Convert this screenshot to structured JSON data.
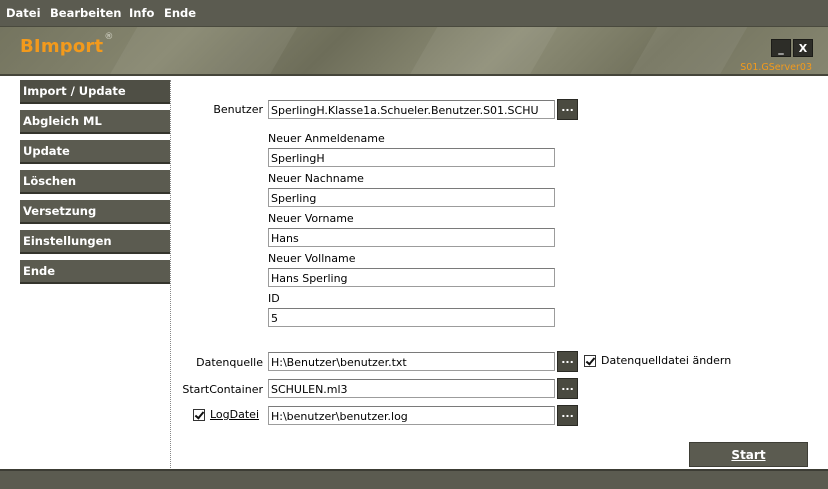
{
  "menu": {
    "items": [
      "Datei",
      "Bearbeiten",
      "Info",
      "Ende"
    ]
  },
  "header": {
    "title": "BImport",
    "title_mark": "®",
    "minimize_label": "_",
    "close_label": "X",
    "server": "S01.GServer03",
    "accent_color": "#f39a1c"
  },
  "nav": {
    "items": [
      "Import / Update",
      "Abgleich ML",
      "Update",
      "Löschen",
      "Versetzung",
      "Einstellungen",
      "Ende"
    ]
  },
  "form": {
    "benutzer_label": "Benutzer",
    "benutzer_value": "SperlingH.Klasse1a.Schueler.Benutzer.S01.SCHU",
    "browse_label": "...",
    "anmeldename_label": "Neuer Anmeldename",
    "anmeldename_value": "SperlingH",
    "nachname_label": "Neuer Nachname",
    "nachname_value": "Sperling",
    "vorname_label": "Neuer Vorname",
    "vorname_value": "Hans",
    "vollname_label": "Neuer Vollname",
    "vollname_value": "Hans Sperling",
    "id_label": "ID",
    "id_value": "5",
    "datenquelle_label": "Datenquelle",
    "datenquelle_value": "H:\\Benutzer\\benutzer.txt",
    "datenquelle_change_label": "Datenquelldatei ändern",
    "datenquelle_change_checked": true,
    "startcontainer_label": "StartContainer",
    "startcontainer_value": "SCHULEN.ml3",
    "logdatei_label": "LogDatei",
    "logdatei_checked": true,
    "logdatei_value": "H:\\benutzer\\benutzer.log",
    "start_label": "Start"
  }
}
